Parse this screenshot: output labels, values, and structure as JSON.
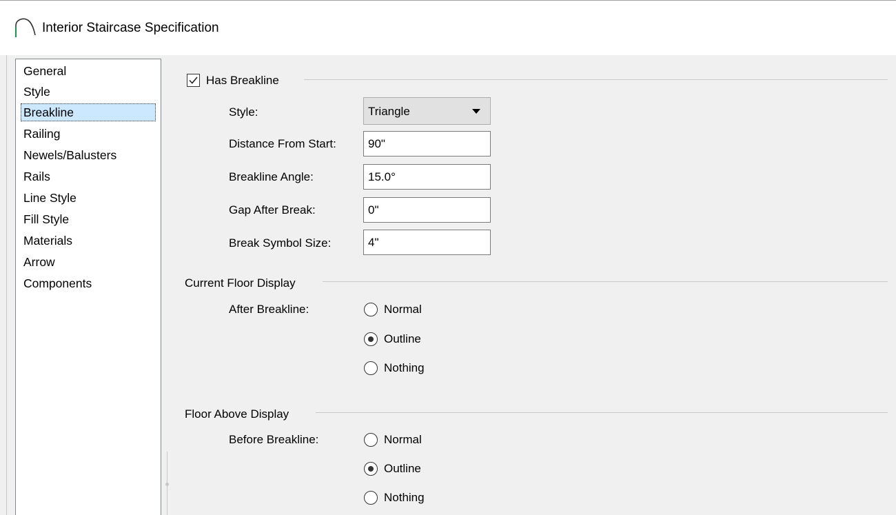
{
  "window": {
    "title": "Interior Staircase Specification"
  },
  "nav": {
    "items": [
      {
        "label": "General",
        "selected": false
      },
      {
        "label": "Style",
        "selected": false
      },
      {
        "label": "Breakline",
        "selected": true
      },
      {
        "label": "Railing",
        "selected": false
      },
      {
        "label": "Newels/Balusters",
        "selected": false
      },
      {
        "label": "Rails",
        "selected": false
      },
      {
        "label": "Line Style",
        "selected": false
      },
      {
        "label": "Fill Style",
        "selected": false
      },
      {
        "label": "Materials",
        "selected": false
      },
      {
        "label": "Arrow",
        "selected": false
      },
      {
        "label": "Components",
        "selected": false
      }
    ]
  },
  "breakline": {
    "has_breakline": {
      "label": "Has Breakline",
      "checked": true
    },
    "style": {
      "label": "Style:",
      "value": "Triangle"
    },
    "distance_from_start": {
      "label": "Distance From Start:",
      "value": "90\""
    },
    "breakline_angle": {
      "label": "Breakline Angle:",
      "value": "15.0°"
    },
    "gap_after_break": {
      "label": "Gap After Break:",
      "value": "0\""
    },
    "break_symbol_size": {
      "label": "Break Symbol Size:",
      "value": "4\""
    }
  },
  "current_floor": {
    "group_label": "Current Floor Display",
    "field_label": "After Breakline:",
    "options": [
      "Normal",
      "Outline",
      "Nothing"
    ],
    "selected": "Outline"
  },
  "floor_above": {
    "group_label": "Floor Above Display",
    "field_label": "Before Breakline:",
    "options": [
      "Normal",
      "Outline",
      "Nothing"
    ],
    "selected": "Outline"
  }
}
